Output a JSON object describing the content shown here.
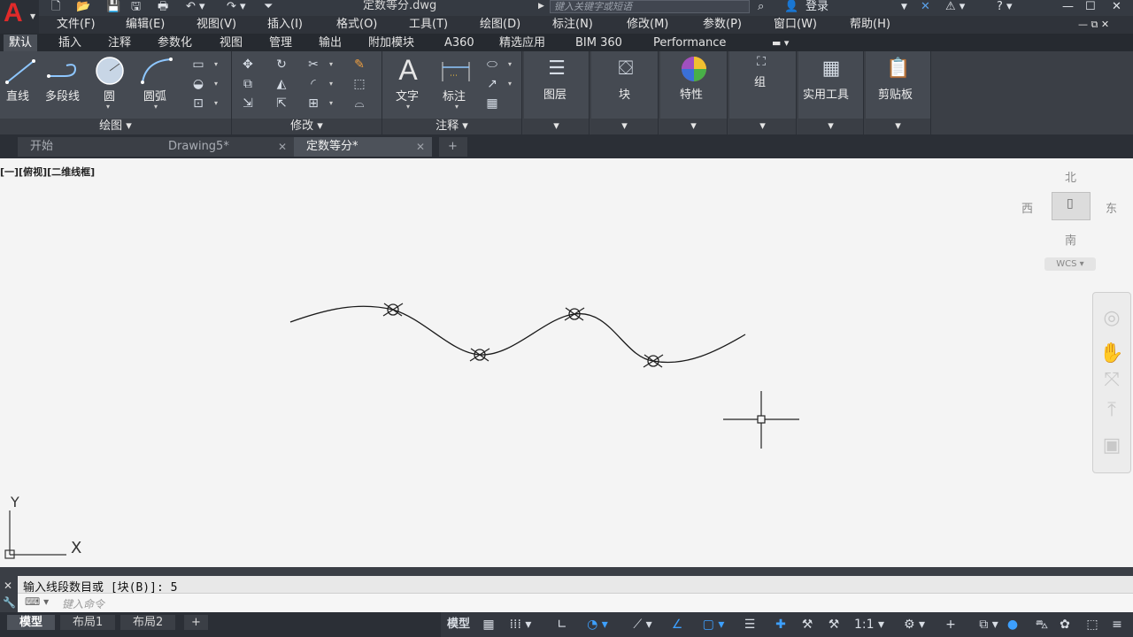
{
  "app": {
    "logo_letter": "A",
    "document_title": "定数等分.dwg",
    "search_placeholder": "键入关键字或短语",
    "login_label": "登录"
  },
  "menubar": [
    "文件(F)",
    "编辑(E)",
    "视图(V)",
    "插入(I)",
    "格式(O)",
    "工具(T)",
    "绘图(D)",
    "标注(N)",
    "修改(M)",
    "参数(P)",
    "窗口(W)",
    "帮助(H)"
  ],
  "ribbon_tabs": [
    "默认",
    "插入",
    "注释",
    "参数化",
    "视图",
    "管理",
    "输出",
    "附加模块",
    "A360",
    "精选应用",
    "BIM 360",
    "Performance"
  ],
  "ribbon": {
    "draw": {
      "title": "绘图",
      "tools": [
        "直线",
        "多段线",
        "圆",
        "圆弧"
      ]
    },
    "modify": {
      "title": "修改"
    },
    "annotation": {
      "title": "注释",
      "tools": [
        "文字",
        "标注"
      ]
    },
    "panels": [
      "图层",
      "块",
      "特性",
      "组",
      "实用工具",
      "剪贴板"
    ]
  },
  "file_tabs": [
    {
      "label": "开始"
    },
    {
      "label": "Drawing5*"
    },
    {
      "label": "定数等分*"
    }
  ],
  "file_tabs_add": "+",
  "viewport_label": "[一][俯视][二维线框]",
  "viewcube": {
    "north": "北",
    "south": "南",
    "east": "东",
    "west": "西",
    "wcs": "WCS"
  },
  "ucs": {
    "x_label": "X",
    "y_label": "Y"
  },
  "command": {
    "history": "输入线段数目或 [块(B)]: 5",
    "placeholder": "键入命令"
  },
  "layout_tabs": [
    "模型",
    "布局1",
    "布局2"
  ],
  "layout_add": "+",
  "status": {
    "model_label": "模型",
    "scale": "1:1"
  },
  "colors": {
    "accent": "#3da0ff",
    "logo": "#e02a2a",
    "canvas": "#f4f4f4"
  }
}
